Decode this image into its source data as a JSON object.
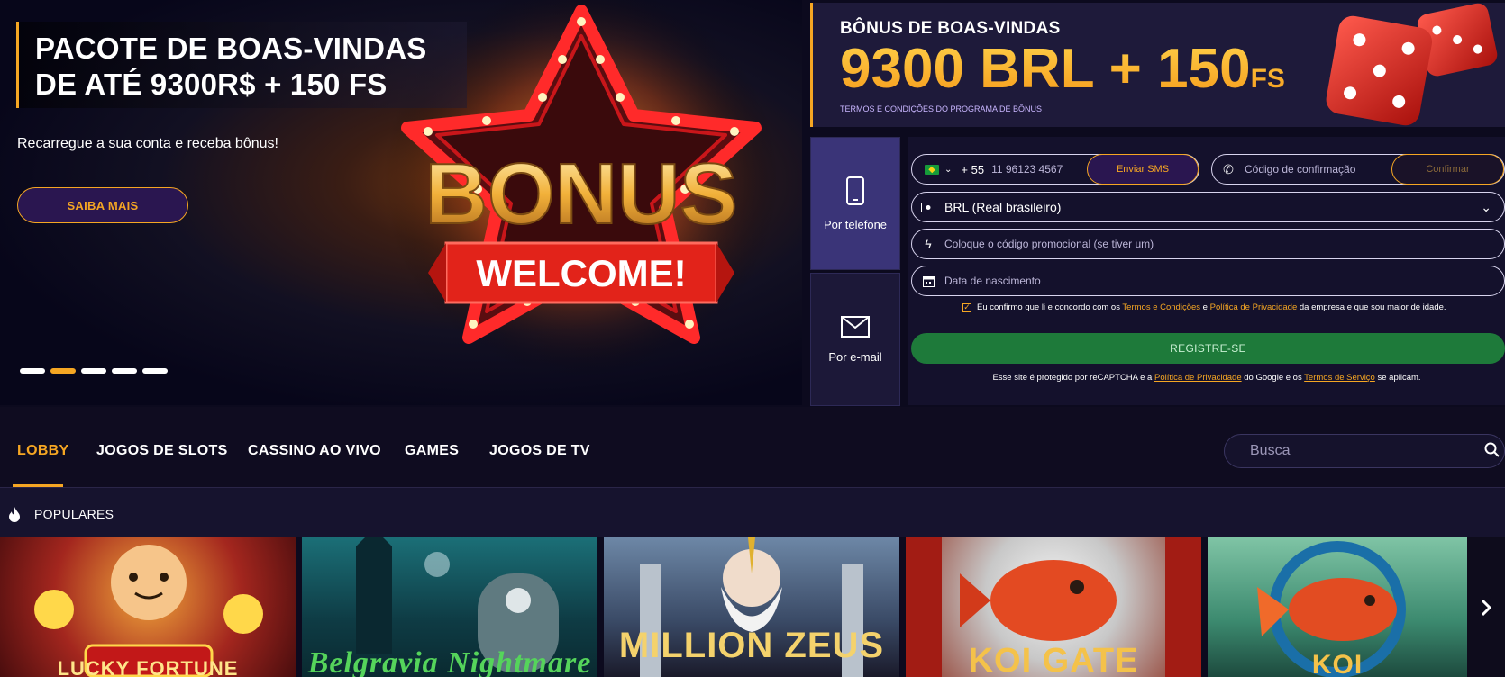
{
  "hero": {
    "title": "PACOTE DE BOAS-VINDAS\nDE ATÉ 9300R$ + 150 FS",
    "subtitle": "Recarregue a sua conta e receba bônus!",
    "cta": "SAIBA MAIS",
    "badge_word": "BONUS",
    "badge_ribbon": "WELCOME!",
    "slides_total": 5,
    "slide_active": 2
  },
  "bonus": {
    "label": "BÔNUS DE BOAS-VINDAS",
    "amount": "9300 BRL + 150",
    "amount_suffix": "FS",
    "terms_link": "TERMOS E CONDIÇÕES DO PROGRAMA DE BÔNUS"
  },
  "register": {
    "tabs": [
      {
        "label": "Por telefone",
        "icon": "phone-icon",
        "active": true
      },
      {
        "label": "Por e-mail",
        "icon": "envelope-icon",
        "active": false
      }
    ],
    "phone_prefix": "+ 55",
    "phone_placeholder": "11 96123 4567",
    "sms_button": "Enviar SMS",
    "code_placeholder": "Código de confirmação",
    "confirm_button": "Confirmar",
    "currency": "BRL (Real brasileiro)",
    "promo_placeholder": "Coloque o código promocional (se tiver um)",
    "dob_placeholder": "Data de nascimento",
    "consent_pre": "Eu confirmo que li e concordo com os",
    "consent_terms": "Termos e Condições",
    "consent_and": "e",
    "consent_privacy": "Política de Privacidade",
    "consent_post": "da empresa e que sou maior de idade.",
    "register_button": "REGISTRE-SE",
    "recaptcha_pre": "Esse site é protegido por reCAPTCHA e a",
    "recaptcha_privacy": "Política de Privacidade",
    "recaptcha_mid": "do Google e os",
    "recaptcha_terms": "Termos de Serviço",
    "recaptcha_post": "se aplicam."
  },
  "nav": {
    "items": [
      "LOBBY",
      "JOGOS DE SLOTS",
      "CASSINO AO VIVO",
      "GAMES",
      "JOGOS DE TV"
    ],
    "active": "LOBBY",
    "search_placeholder": "Busca"
  },
  "popular": {
    "title": "POPULARES",
    "games": [
      "LUCKY FORTUNE",
      "Belgravia Nightmare",
      "MILLION ZEUS",
      "KOI GATE",
      "KOI"
    ]
  },
  "colors": {
    "accent": "#f5a623",
    "background": "#0c0a1e",
    "register_green": "#1e7a3a",
    "tab_active": "#3a3478"
  }
}
